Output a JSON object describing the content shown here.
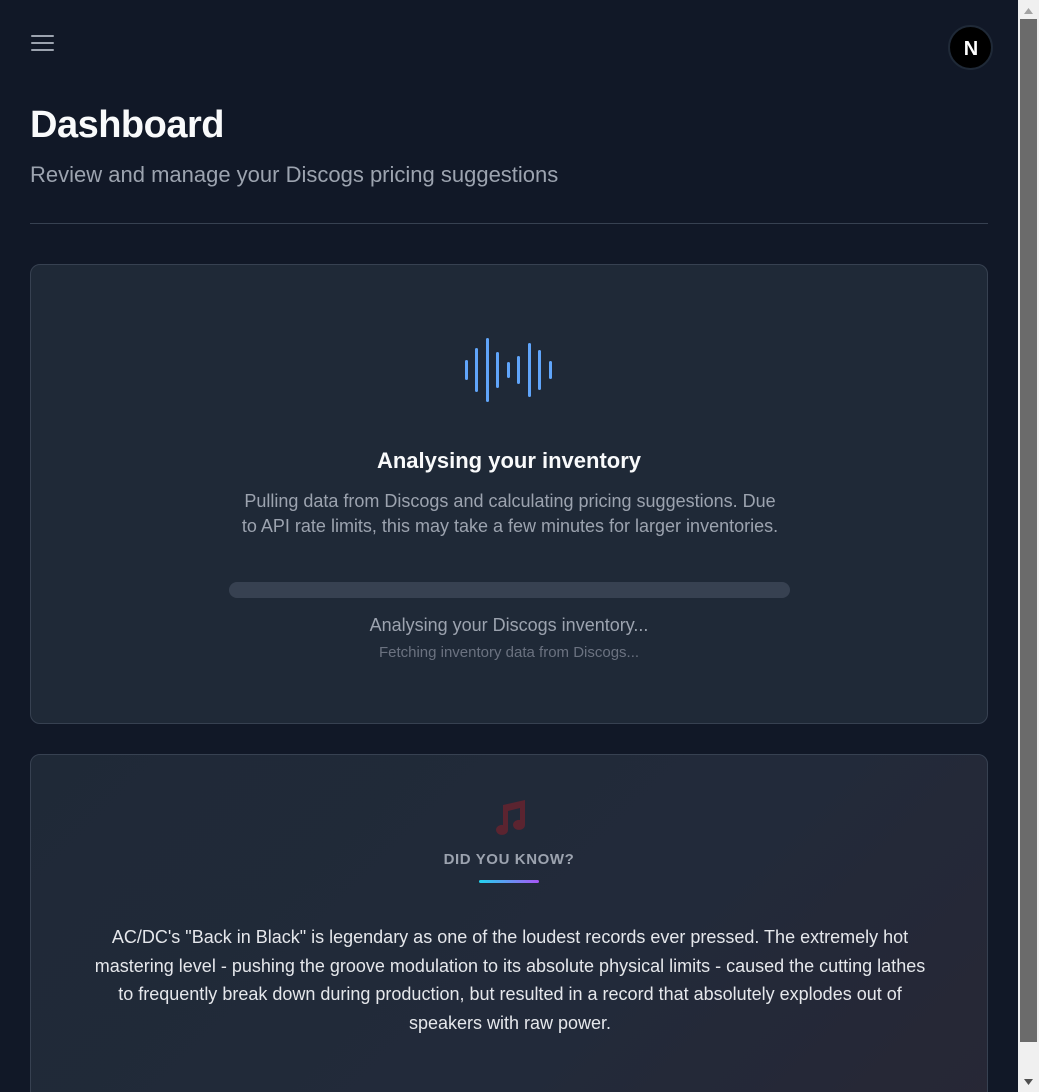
{
  "header": {
    "menu_icon": "hamburger-icon",
    "avatar_letter": "N"
  },
  "page": {
    "title": "Dashboard",
    "subtitle": "Review and manage your Discogs pricing suggestions"
  },
  "analysis": {
    "icon": "audio-waveform-icon",
    "icon_color": "#60a5fa",
    "title": "Analysing your inventory",
    "description": "Pulling data from Discogs and calculating pricing suggestions. Due to API rate limits, this may take a few minutes for larger inventories.",
    "progress_percent": 0,
    "status": "Analysing your Discogs inventory...",
    "substatus": "Fetching inventory data from Discogs..."
  },
  "fact": {
    "icon": "music-note-icon",
    "icon_color": "#5b2430",
    "label": "DID YOU KNOW?",
    "accent_gradient": [
      "#22d3ee",
      "#a855f7"
    ],
    "text": "AC/DC's \"Back in Black\" is legendary as one of the loudest records ever pressed. The extremely hot mastering level - pushing the groove modulation to its absolute physical limits - caused the cutting lathes to frequently break down during production, but resulted in a record that absolutely explodes out of speakers with raw power."
  },
  "colors": {
    "background": "#111827",
    "card": "#1f2937",
    "border": "#374151",
    "accent": "#3b82f6"
  }
}
